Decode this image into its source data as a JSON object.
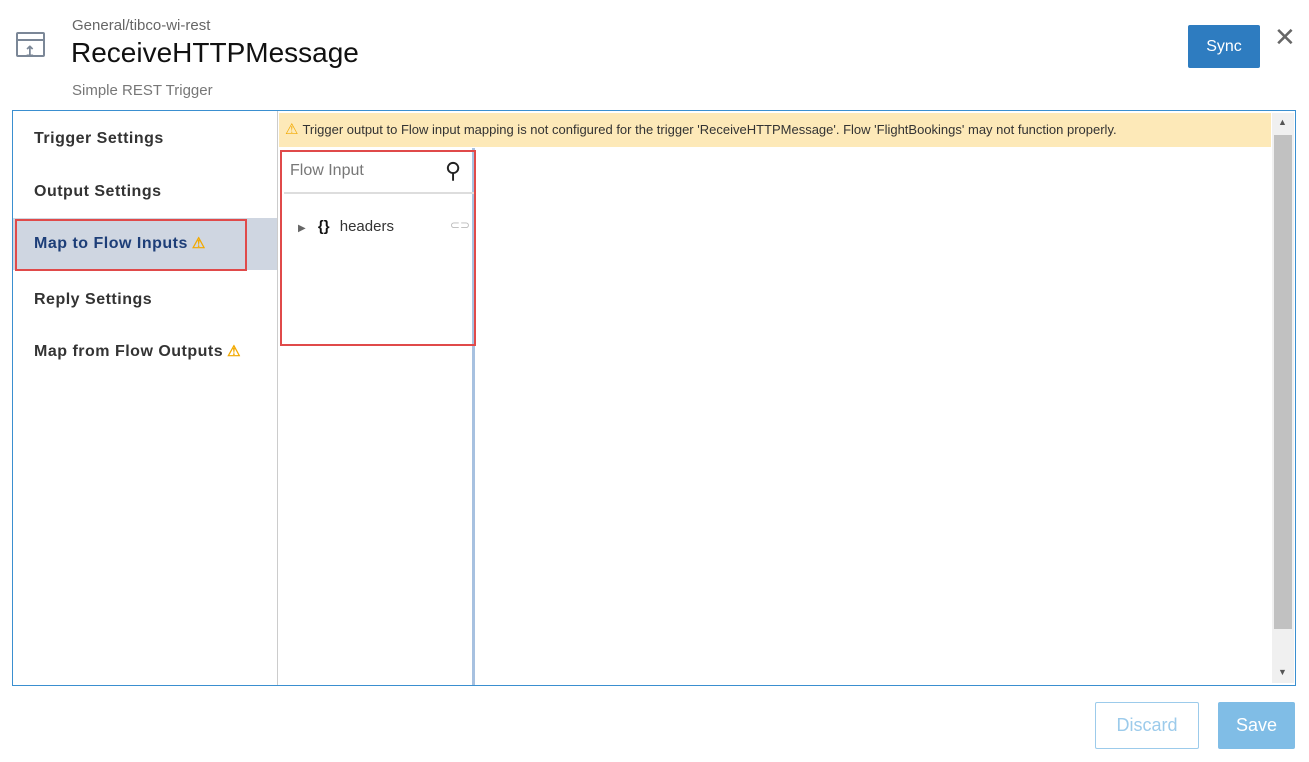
{
  "header": {
    "breadcrumb": "General/tibco-wi-rest",
    "title": "ReceiveHTTPMessage",
    "subtitle": "Simple REST Trigger",
    "sync_label": "Sync",
    "close_label": "✕"
  },
  "nav": {
    "items": [
      {
        "label": "Trigger Settings"
      },
      {
        "label": "Output Settings"
      },
      {
        "label": "Map to Flow Inputs",
        "warning": true
      },
      {
        "label": "Reply Settings"
      },
      {
        "label": "Map from Flow Outputs",
        "warning": true
      }
    ]
  },
  "banner": {
    "text": "Trigger output to Flow input mapping is not configured for the trigger 'ReceiveHTTPMessage'. Flow 'FlightBookings' may not function properly."
  },
  "flow_input": {
    "placeholder": "Flow Input",
    "tree": [
      {
        "label": "headers",
        "icon": "{}"
      }
    ]
  },
  "footer": {
    "discard_label": "Discard",
    "save_label": "Save"
  },
  "colors": {
    "accent": "#2e7cc0",
    "warning": "#f2a900",
    "highlight": "#e04a4a"
  }
}
